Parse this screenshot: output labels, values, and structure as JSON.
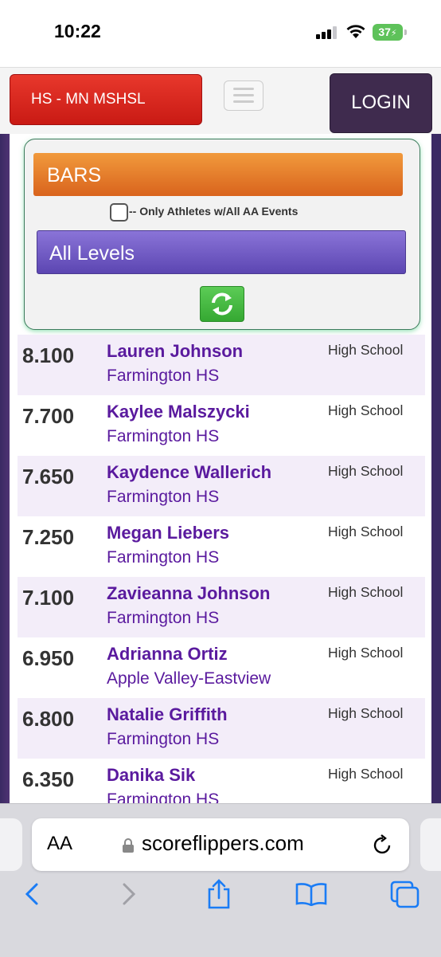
{
  "status_bar": {
    "time": "10:22",
    "battery": "37"
  },
  "header": {
    "state_label": "HS - MN MSHSL",
    "login_label": "LOGIN"
  },
  "filters": {
    "event": "BARS",
    "aa_label": "-- Only Athletes w/All AA Events",
    "level": "All Levels"
  },
  "results": [
    {
      "score": "8.100",
      "athlete": "Lauren Johnson",
      "team": "Farmington HS",
      "level": "High School"
    },
    {
      "score": "7.700",
      "athlete": "Kaylee Malszycki",
      "team": "Farmington HS",
      "level": "High School"
    },
    {
      "score": "7.650",
      "athlete": "Kaydence Wallerich",
      "team": "Farmington HS",
      "level": "High School"
    },
    {
      "score": "7.250",
      "athlete": "Megan Liebers",
      "team": "Farmington HS",
      "level": "High School"
    },
    {
      "score": "7.100",
      "athlete": "Zavieanna Johnson",
      "team": "Farmington HS",
      "level": "High School"
    },
    {
      "score": "6.950",
      "athlete": "Adrianna Ortiz",
      "team": "Apple Valley-Eastview",
      "level": "High School"
    },
    {
      "score": "6.800",
      "athlete": "Natalie Griffith",
      "team": "Farmington HS",
      "level": "High School"
    },
    {
      "score": "6.350",
      "athlete": "Danika Sik",
      "team": "Farmington HS",
      "level": "High School"
    }
  ],
  "browser": {
    "aa_label": "AA",
    "url": "scoreflippers.com"
  },
  "colors": {
    "state_red": "#d42a20",
    "login_purple": "#3f2b4e",
    "event_orange": "#e47a2b",
    "level_purple": "#6a55c0",
    "name_purple": "#5a1a9e",
    "row_alt": "#f3edf9",
    "refresh_green": "#44b540"
  }
}
